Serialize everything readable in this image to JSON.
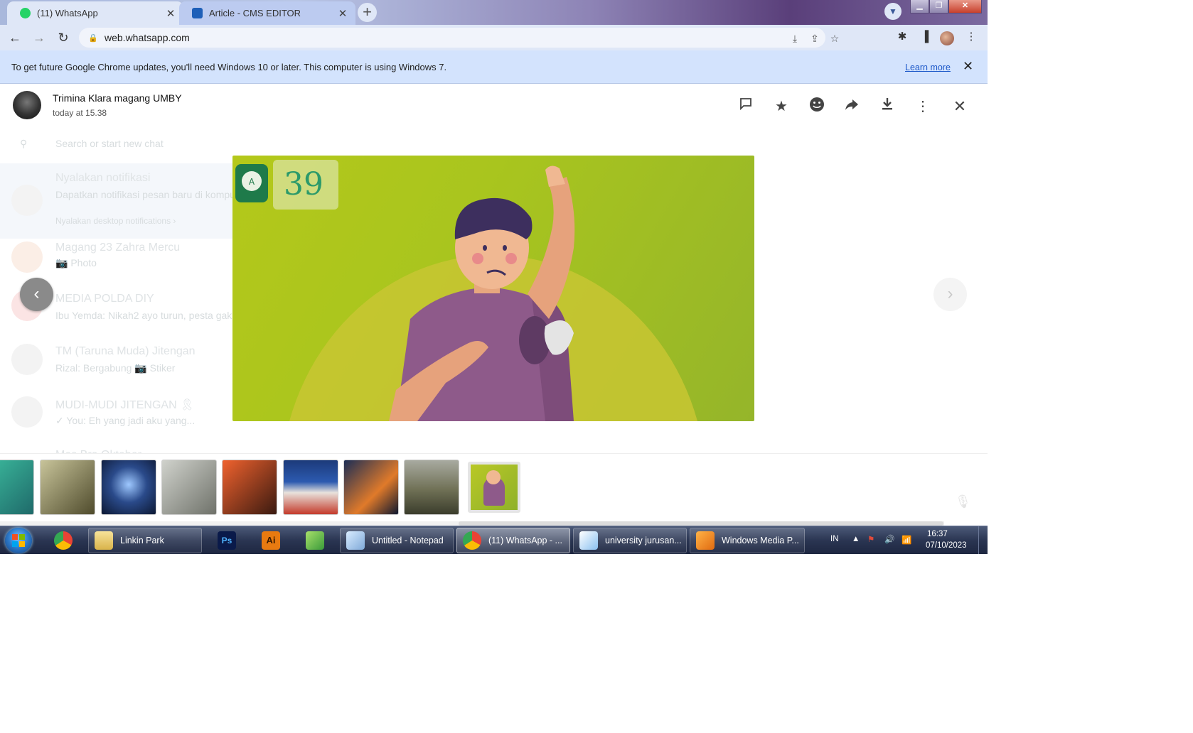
{
  "browser": {
    "tabs": [
      {
        "title": "(11) WhatsApp",
        "favicon": "whatsapp-icon",
        "active": true
      },
      {
        "title": "Article - CMS EDITOR",
        "favicon": "cms-icon",
        "active": false
      }
    ],
    "new_tab_label": "+",
    "tab_search_icon": "chevron-down-icon",
    "window_buttons": {
      "minimize": "▁",
      "maximize": "❐",
      "close": "✕"
    },
    "url": "web.whatsapp.com",
    "infobar": {
      "message": "To get future Google Chrome updates, you'll need Windows 10 or later. This computer is using Windows 7.",
      "link": "Learn more"
    }
  },
  "media_viewer": {
    "sender": "Trimina Klara magang UMBY",
    "timestamp": "today at 15.38",
    "actions": [
      "reply-icon",
      "star-icon",
      "emoji-icon",
      "forward-icon",
      "download-icon",
      "menu-icon",
      "close-icon"
    ],
    "thumbnails": [
      {
        "name": "thumb-cables",
        "color": "#2a8a7a"
      },
      {
        "name": "thumb-model",
        "color": "#6e6a42"
      },
      {
        "name": "thumb-fireworks",
        "color": "#1a2a55"
      },
      {
        "name": "thumb-couple",
        "color": "#8a8c84"
      },
      {
        "name": "thumb-phone-app",
        "color": "#d84a1e"
      },
      {
        "name": "thumb-store",
        "color": "#1c3a7a"
      },
      {
        "name": "thumb-dancer",
        "color": "#15233f"
      },
      {
        "name": "thumb-building",
        "color": "#6f7055"
      },
      {
        "name": "thumb-sweating-man",
        "color": "#a9c41e"
      }
    ]
  },
  "background_chats": {
    "search_placeholder": "Search or start new chat",
    "items": [
      {
        "title": "Nyalakan notifikasi",
        "subtitle": "Dapatkan notifikasi pesan baru di komputer Anda",
        "extra": "Nyalakan desktop notifications ›"
      },
      {
        "title": "Magang 23 Zahra Mercu",
        "subtitle": "📷 Photo"
      },
      {
        "title": "MEDIA POLDA DIY",
        "subtitle": "Ibu Yemda: Nikah2 ayo turun, pesta gak..."
      },
      {
        "title": "TM (Taruna Muda) Jitengan",
        "subtitle": "Rizal: Bergabung 📷 Stiker"
      },
      {
        "title": "MUDI-MUDI JITENGAN 🎗",
        "subtitle": "✓ You: Eh yang jadi aku yang..."
      },
      {
        "title": "Mas Bro Oktober",
        "subtitle": ""
      }
    ]
  },
  "taskbar": {
    "items": [
      {
        "label": "",
        "icon": "chrome-icon"
      },
      {
        "label": "Linkin Park",
        "icon": "folder-icon"
      },
      {
        "label": "",
        "icon": "photoshop-icon"
      },
      {
        "label": "",
        "icon": "illustrator-icon"
      },
      {
        "label": "",
        "icon": "green-app-icon"
      },
      {
        "label": "Untitled - Notepad",
        "icon": "notepad-icon"
      },
      {
        "label": "(11) WhatsApp - ...",
        "icon": "chrome-icon"
      },
      {
        "label": "university jurusan...",
        "icon": "paint-icon"
      },
      {
        "label": "Windows Media P...",
        "icon": "media-player-icon"
      }
    ],
    "language": "IN",
    "clock_time": "16:37",
    "clock_date": "07/10/2023"
  },
  "colors": {
    "chrome_frame": "#dfe7f7",
    "infobar": "#d3e3fd",
    "link": "#1a56c8",
    "media_bg": "#a9c51e",
    "shirt": "#8e5a8a"
  }
}
